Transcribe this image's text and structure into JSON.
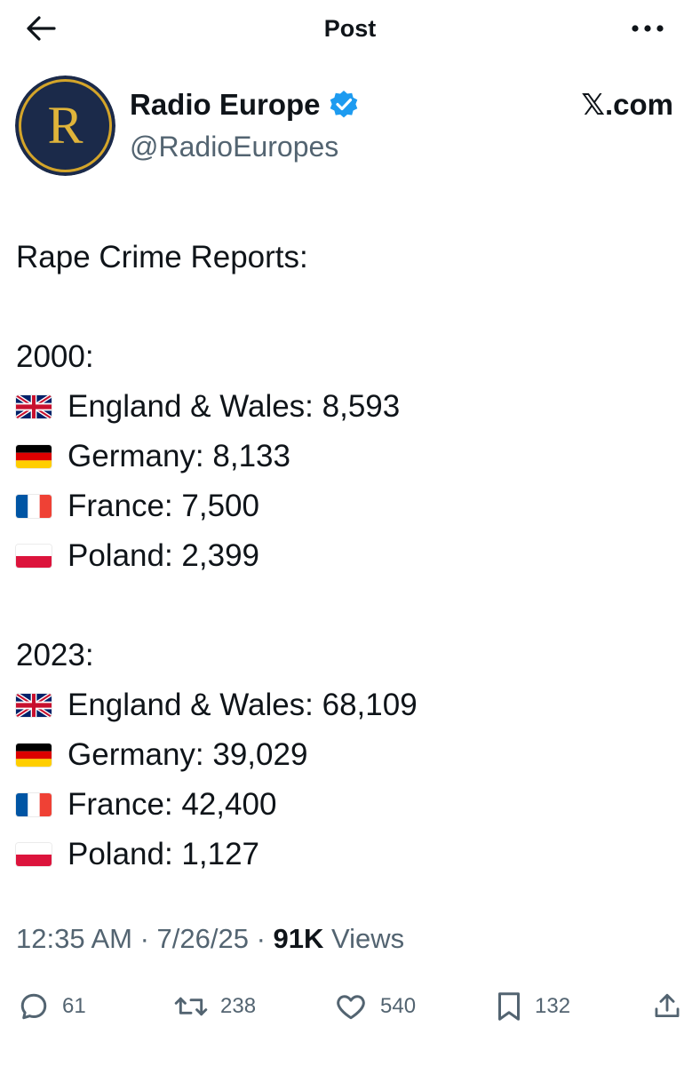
{
  "header": {
    "title": "Post",
    "back_icon": "arrow-left-icon",
    "more_icon": "more-horizontal-icon"
  },
  "author": {
    "avatar_letter": "R",
    "name": "Radio Europe",
    "handle": "@RadioEuropes",
    "verified_icon": "verified-badge-icon",
    "colors": {
      "avatar_bg": "#1b2a4a",
      "avatar_ring": "#d4a52a",
      "verified": "#1d9bf0"
    }
  },
  "watermark": "𝕏.com",
  "post": {
    "heading": "Rape Crime Reports:",
    "sections": [
      {
        "year_label": "2000:",
        "rows": [
          {
            "flag": "uk",
            "text": "England & Wales: 8,593"
          },
          {
            "flag": "de",
            "text": "Germany: 8,133"
          },
          {
            "flag": "fr",
            "text": "France: 7,500"
          },
          {
            "flag": "pl",
            "text": "Poland: 2,399"
          }
        ]
      },
      {
        "year_label": "2023:",
        "rows": [
          {
            "flag": "uk",
            "text": "England & Wales: 68,109"
          },
          {
            "flag": "de",
            "text": "Germany: 39,029"
          },
          {
            "flag": "fr",
            "text": "France: 42,400"
          },
          {
            "flag": "pl",
            "text": "Poland: 1,127"
          }
        ]
      }
    ]
  },
  "meta": {
    "time": "12:35 AM",
    "sep1": " · ",
    "date": "7/26/25",
    "sep2": " · ",
    "views_count": "91K",
    "views_label": " Views"
  },
  "actions": {
    "replies": {
      "icon": "reply-icon",
      "count": "61"
    },
    "reposts": {
      "icon": "repost-icon",
      "count": "238"
    },
    "likes": {
      "icon": "heart-icon",
      "count": "540"
    },
    "bookmarks": {
      "icon": "bookmark-icon",
      "count": "132"
    },
    "share": {
      "icon": "share-icon"
    }
  }
}
